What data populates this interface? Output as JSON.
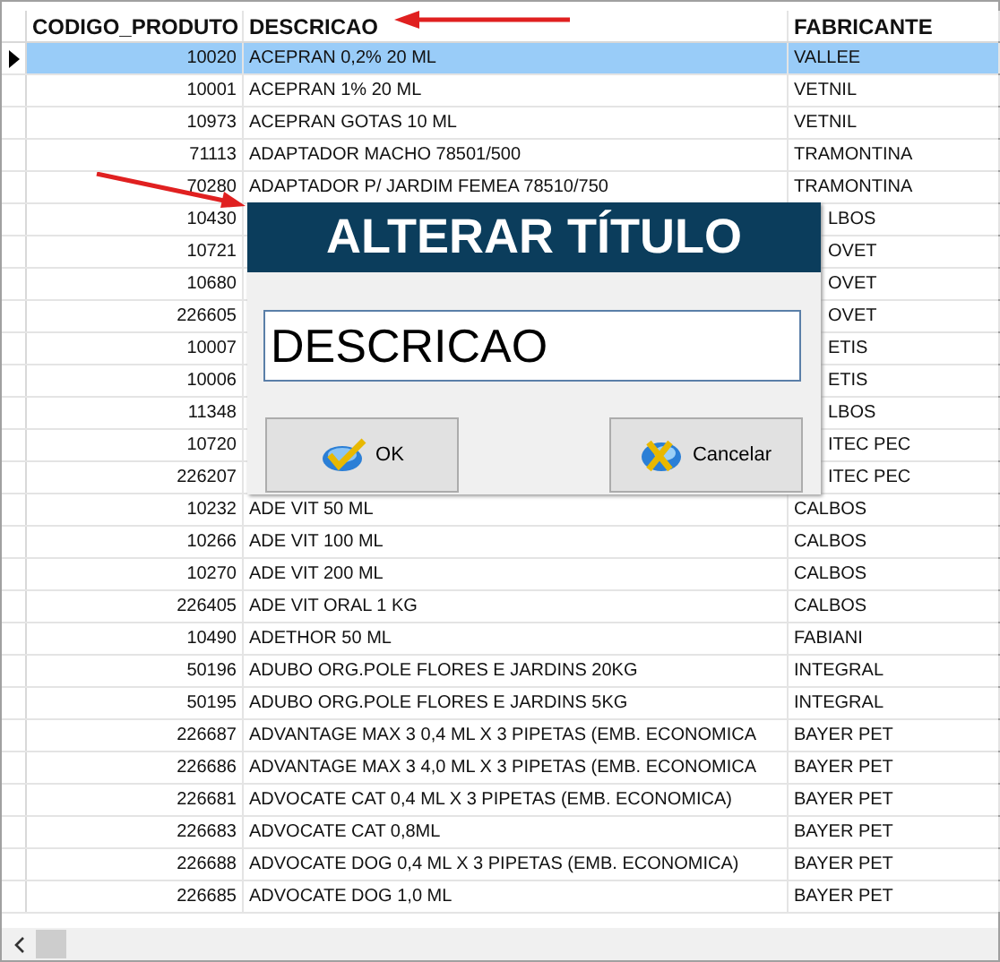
{
  "grid": {
    "columns": [
      "CODIGO_PRODUTO",
      "DESCRICAO",
      "FABRICANTE"
    ],
    "rows": [
      {
        "codigo": "10020",
        "descricao": "ACEPRAN 0,2% 20 ML",
        "fabricante": "VALLEE",
        "selected": true
      },
      {
        "codigo": "10001",
        "descricao": "ACEPRAN 1%  20 ML",
        "fabricante": "VETNIL",
        "selected": false
      },
      {
        "codigo": "10973",
        "descricao": "ACEPRAN GOTAS 10 ML",
        "fabricante": "VETNIL",
        "selected": false
      },
      {
        "codigo": "71113",
        "descricao": "ADAPTADOR MACHO 78501/500",
        "fabricante": "TRAMONTINA",
        "selected": false
      },
      {
        "codigo": "70280",
        "descricao": "ADAPTADOR P/ JARDIM FEMEA 78510/750",
        "fabricante": "TRAMONTINA",
        "selected": false
      },
      {
        "codigo": "10430",
        "fabricante": "LBOS",
        "selected": false
      },
      {
        "codigo": "10721",
        "fabricante": "OVET",
        "selected": false
      },
      {
        "codigo": "10680",
        "fabricante": "OVET",
        "selected": false
      },
      {
        "codigo": "226605",
        "fabricante": "OVET",
        "selected": false
      },
      {
        "codigo": "10007",
        "fabricante": "ETIS",
        "selected": false
      },
      {
        "codigo": "10006",
        "fabricante": "ETIS",
        "selected": false
      },
      {
        "codigo": "11348",
        "fabricante": "LBOS",
        "selected": false
      },
      {
        "codigo": "10720",
        "fabricante": "ITEC PEC",
        "selected": false
      },
      {
        "codigo": "226207",
        "fabricante": "ITEC PEC",
        "selected": false
      },
      {
        "codigo": "10232",
        "descricao": "ADE VIT  50 ML",
        "fabricante": "CALBOS",
        "selected": false
      },
      {
        "codigo": "10266",
        "descricao": "ADE VIT 100 ML",
        "fabricante": "CALBOS",
        "selected": false
      },
      {
        "codigo": "10270",
        "descricao": "ADE VIT 200 ML",
        "fabricante": "CALBOS",
        "selected": false
      },
      {
        "codigo": "226405",
        "descricao": "ADE VIT ORAL  1 KG",
        "fabricante": "CALBOS",
        "selected": false
      },
      {
        "codigo": "10490",
        "descricao": "ADETHOR  50 ML",
        "fabricante": "FABIANI",
        "selected": false
      },
      {
        "codigo": "50196",
        "descricao": "ADUBO ORG.POLE FLORES E JARDINS 20KG",
        "fabricante": "INTEGRAL",
        "selected": false
      },
      {
        "codigo": "50195",
        "descricao": "ADUBO ORG.POLE FLORES E JARDINS 5KG",
        "fabricante": "INTEGRAL",
        "selected": false
      },
      {
        "codigo": "226687",
        "descricao": "ADVANTAGE MAX 3 0,4 ML X 3 PIPETAS (EMB. ECONOMICA",
        "fabricante": "BAYER PET",
        "selected": false
      },
      {
        "codigo": "226686",
        "descricao": "ADVANTAGE MAX 3 4,0 ML X 3 PIPETAS (EMB. ECONOMICA",
        "fabricante": "BAYER PET",
        "selected": false
      },
      {
        "codigo": "226681",
        "descricao": "ADVOCATE CAT 0,4 ML X 3 PIPETAS (EMB. ECONOMICA)",
        "fabricante": "BAYER PET",
        "selected": false
      },
      {
        "codigo": "226683",
        "descricao": "ADVOCATE CAT 0,8ML",
        "fabricante": "BAYER PET",
        "selected": false
      },
      {
        "codigo": "226688",
        "descricao": "ADVOCATE DOG 0,4 ML X 3 PIPETAS (EMB. ECONOMICA)",
        "fabricante": "BAYER PET",
        "selected": false
      },
      {
        "codigo": "226685",
        "descricao": "ADVOCATE DOG 1,0 ML",
        "fabricante": "BAYER PET",
        "selected": false
      }
    ]
  },
  "dialog": {
    "title": "ALTERAR TÍTULO",
    "value": "DESCRICAO",
    "buttons": [
      {
        "kind": "ok",
        "label": "OK"
      },
      {
        "kind": "cancel",
        "label": "Cancelar"
      }
    ]
  }
}
